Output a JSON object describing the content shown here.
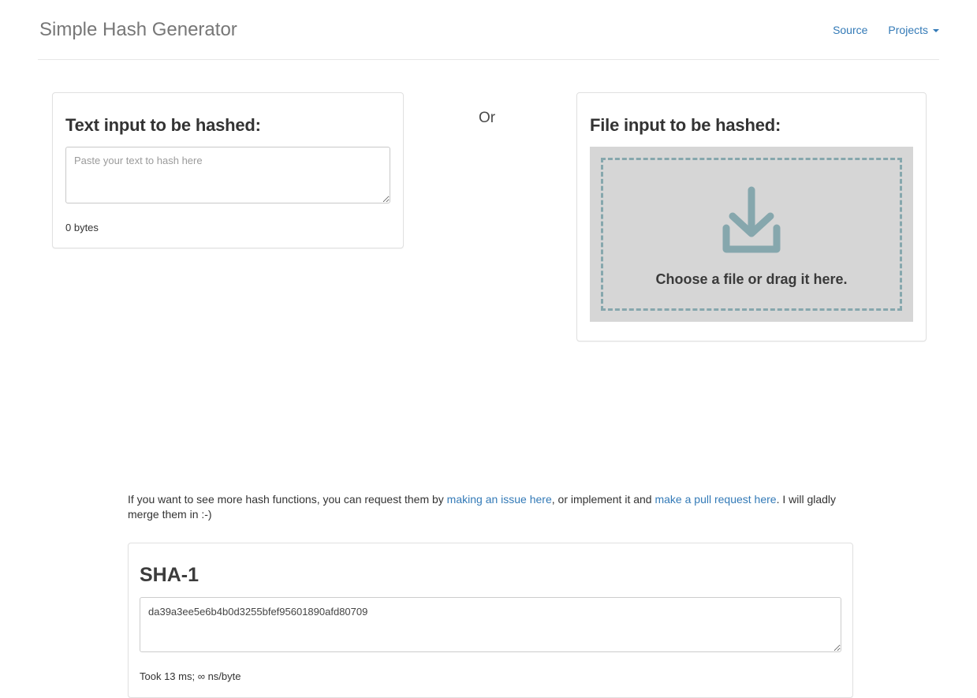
{
  "header": {
    "brand": "Simple Hash Generator",
    "nav": [
      {
        "label": "Source",
        "icon": "",
        "has_caret": false
      },
      {
        "label": "Projects",
        "icon": "chevron-down-icon",
        "has_caret": true
      }
    ]
  },
  "text_input": {
    "heading": "Text input to be hashed:",
    "placeholder": "Paste your text to hash here",
    "value": "",
    "byte_count": "0 bytes"
  },
  "separator": {
    "label": "Or"
  },
  "file_input": {
    "heading": "File input to be hashed:",
    "dropzone_label": "Choose a file or drag it here.",
    "dropzone_icon": "download-arrow-icon"
  },
  "note": {
    "part1": "If you want to see more hash functions, you can request them by ",
    "link1": "making an issue here",
    "part2": ", or implement it and ",
    "link2": "make a pull request here",
    "part3": ". I will gladly merge them in :-)"
  },
  "result": {
    "algorithm": "SHA-1",
    "hash": "da39a3ee5e6b4b0d3255bfef95601890afd80709",
    "timing": "Took 13 ms; ∞ ns/byte"
  },
  "colors": {
    "link": "#337ab7",
    "brand_text": "#777777",
    "dropzone_bg": "#d6d6d6",
    "dropzone_border": "#86a7ad",
    "dropzone_icon": "#86a7ad",
    "panel_border": "#e0e0e0"
  }
}
